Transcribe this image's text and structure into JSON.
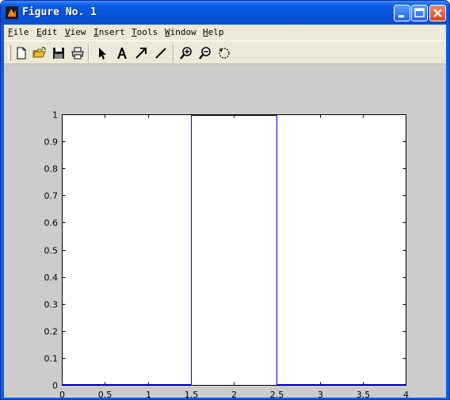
{
  "window": {
    "title": "Figure No. 1"
  },
  "menu": {
    "items": [
      "File",
      "Edit",
      "View",
      "Insert",
      "Tools",
      "Window",
      "Help"
    ]
  },
  "toolbar": {
    "tools": [
      "new-file-icon",
      "open-folder-icon",
      "save-icon",
      "print-icon",
      "select-arrow-icon",
      "insert-text-icon",
      "insert-arrow-icon",
      "insert-line-icon",
      "zoom-in-icon",
      "zoom-out-icon",
      "rotate-3d-icon"
    ]
  },
  "colors": {
    "series": "#0000ff",
    "figure_background": "#cccccc",
    "axes_background": "#ffffff"
  },
  "chart_data": {
    "type": "line",
    "xlim": [
      0,
      4
    ],
    "ylim": [
      0,
      1
    ],
    "x_ticks": [
      "0",
      "0.5",
      "1",
      "1.5",
      "2",
      "2.5",
      "3",
      "3.5",
      "4"
    ],
    "y_ticks": [
      "0",
      "0.1",
      "0.2",
      "0.3",
      "0.4",
      "0.5",
      "0.6",
      "0.7",
      "0.8",
      "0.9",
      "1"
    ],
    "grid": false,
    "series": [
      {
        "x": [
          0,
          1.5,
          1.5,
          2.5,
          2.5,
          4
        ],
        "y": [
          0,
          0,
          1,
          1,
          0,
          0
        ]
      }
    ]
  }
}
